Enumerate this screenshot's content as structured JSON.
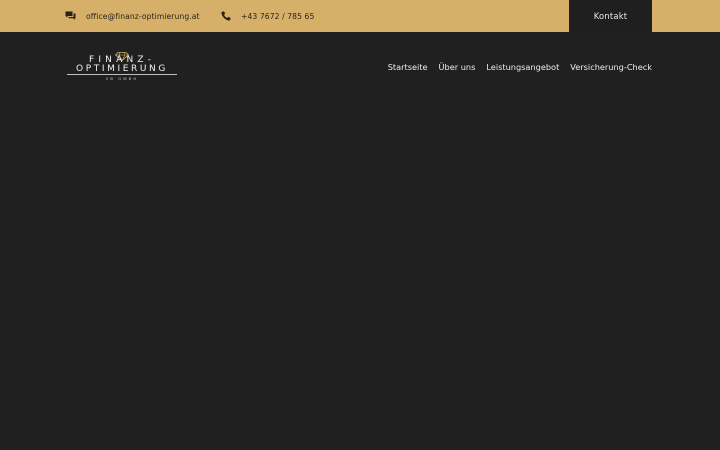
{
  "topbar": {
    "email": "office@finanz-optimierung.at",
    "phone": "+43 7672 / 785 65",
    "contact_button": "Kontakt",
    "background_color": "#d6b068"
  },
  "logo": {
    "line1": "FINANZ-",
    "line2": "OPTIMIERUNG",
    "line3": "VB GMBH"
  },
  "nav": {
    "items": [
      {
        "label": "Startseite"
      },
      {
        "label": "Über uns"
      },
      {
        "label": "Leistungsangebot"
      },
      {
        "label": "Versicherung-Check"
      }
    ]
  },
  "icons": {
    "email": "chat-bubbles-icon",
    "phone": "phone-icon",
    "logo": "diamond-icon"
  },
  "page": {
    "background_color": "#202020"
  }
}
